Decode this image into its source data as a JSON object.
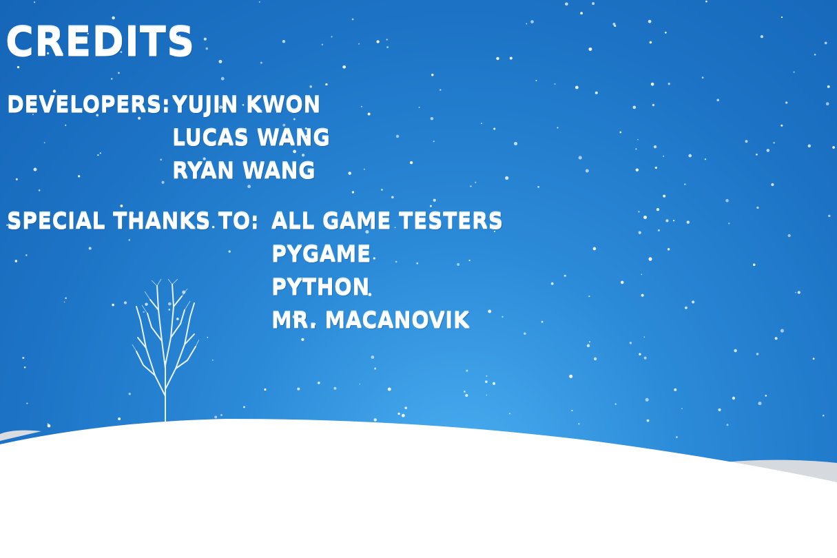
{
  "screen": "credits",
  "title": "CREDITS",
  "developers": {
    "label": "DEVELOPERS:",
    "names": [
      "YUJIN KWON",
      "LUCAS WANG",
      "RYAN WANG"
    ]
  },
  "special_thanks": {
    "label": "SPECIAL THANKS TO:",
    "names": [
      "ALL GAME TESTERS",
      "PYGAME",
      "PYTHON",
      "MR. MACANOVIK"
    ]
  },
  "colors": {
    "sky_top": "#1565b8",
    "sky_glow": "#4aaef0",
    "snow": "#ffffff",
    "text": "#ffffff"
  }
}
